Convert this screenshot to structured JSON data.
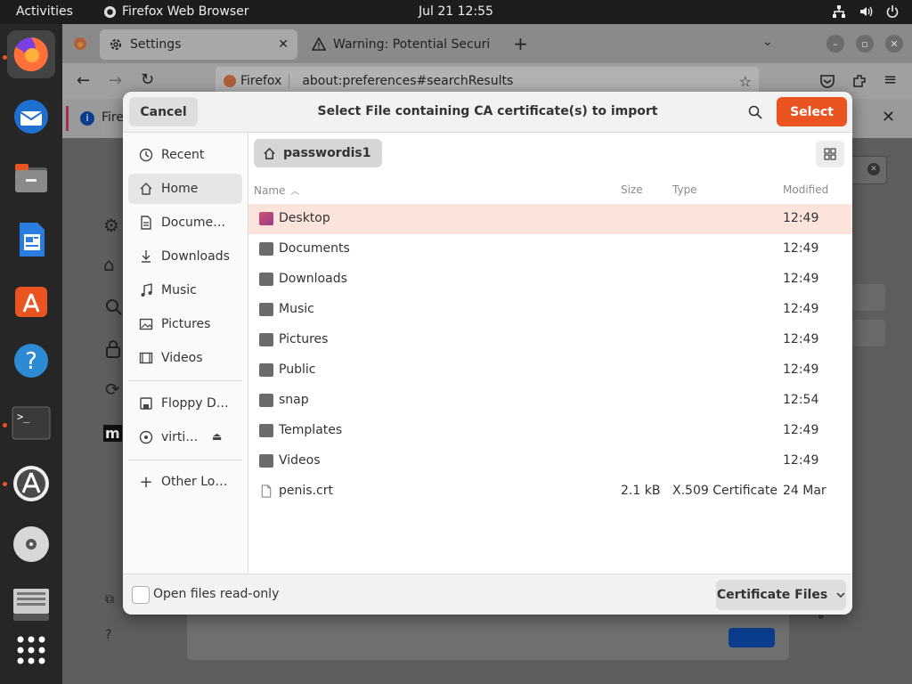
{
  "topbar": {
    "activities": "Activities",
    "app_name": "Firefox Web Browser",
    "clock": "Jul 21  12:55"
  },
  "dock": {
    "items": [
      "firefox-icon",
      "thunderbird-icon",
      "files-icon",
      "writer-icon",
      "app-center-icon",
      "help-icon",
      "terminal-icon",
      "software-updater-icon",
      "dvd-icon",
      "disk-icon",
      "app-grid-icon"
    ]
  },
  "browser": {
    "tabs": [
      {
        "label": "Settings"
      },
      {
        "label": "Warning: Potential Securi"
      }
    ],
    "url_identity": "Firefox",
    "url": "about:preferences#searchResults",
    "notif_text": "Fire"
  },
  "dialog": {
    "title": "Select File containing CA certificate(s) to import",
    "cancel": "Cancel",
    "select": "Select",
    "path": "passwordis1",
    "places": [
      {
        "label": "Recent",
        "icon": "clock-icon"
      },
      {
        "label": "Home",
        "icon": "home-icon"
      },
      {
        "label": "Docume…",
        "icon": "document-icon"
      },
      {
        "label": "Downloads",
        "icon": "download-icon"
      },
      {
        "label": "Music",
        "icon": "music-icon"
      },
      {
        "label": "Pictures",
        "icon": "picture-icon"
      },
      {
        "label": "Videos",
        "icon": "video-icon"
      },
      {
        "label": "Floppy D…",
        "icon": "floppy-icon"
      },
      {
        "label": "virti…",
        "icon": "disc-icon"
      },
      {
        "label": "Other Lo…",
        "icon": "plus-icon"
      }
    ],
    "columns": {
      "name": "Name",
      "size": "Size",
      "type": "Type",
      "modified": "Modified"
    },
    "files": [
      {
        "name": "Desktop",
        "size": "",
        "type": "",
        "modified": "12:49"
      },
      {
        "name": "Documents",
        "size": "",
        "type": "",
        "modified": "12:49"
      },
      {
        "name": "Downloads",
        "size": "",
        "type": "",
        "modified": "12:49"
      },
      {
        "name": "Music",
        "size": "",
        "type": "",
        "modified": "12:49"
      },
      {
        "name": "Pictures",
        "size": "",
        "type": "",
        "modified": "12:49"
      },
      {
        "name": "Public",
        "size": "",
        "type": "",
        "modified": "12:49"
      },
      {
        "name": "snap",
        "size": "",
        "type": "",
        "modified": "12:54"
      },
      {
        "name": "Templates",
        "size": "",
        "type": "",
        "modified": "12:49"
      },
      {
        "name": "Videos",
        "size": "",
        "type": "",
        "modified": "12:49"
      },
      {
        "name": "penis.crt",
        "size": "2.1 kB",
        "type": "X.509 Certificate",
        "modified": "24 Mar"
      }
    ],
    "readonly_label": "Open files read-only",
    "filter": "Certificate Files"
  },
  "colors": {
    "accent": "#e95420",
    "selected_row": "#fbe4db"
  }
}
